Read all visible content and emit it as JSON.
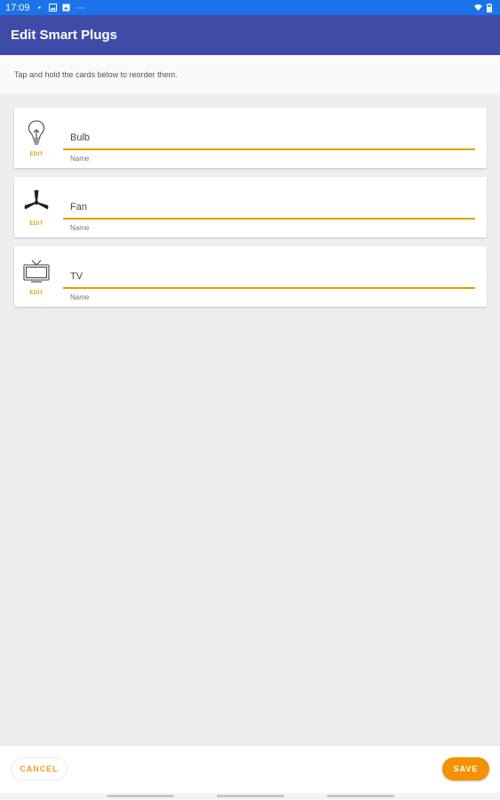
{
  "status_bar": {
    "time": "17:09",
    "left_icons": [
      "dot-icon",
      "image-icon",
      "photo-icon",
      "more-icon"
    ],
    "right_icons": [
      "wifi-icon",
      "battery-icon"
    ]
  },
  "app_bar": {
    "title": "Edit Smart Plugs"
  },
  "hint": {
    "text": "Tap and hold the cards below to reorder them."
  },
  "cards": [
    {
      "icon": "bulb-icon",
      "edit_label": "EDIT",
      "value": "Bulb",
      "helper": "Name"
    },
    {
      "icon": "fan-icon",
      "edit_label": "EDIT",
      "value": "Fan",
      "helper": "Name"
    },
    {
      "icon": "tv-icon",
      "edit_label": "EDIT",
      "value": "TV",
      "helper": "Name"
    }
  ],
  "footer": {
    "cancel_label": "CANCEL",
    "save_label": "SAVE"
  },
  "colors": {
    "status_bar": "#1a73e8",
    "app_bar": "#3f4ba6",
    "accent": "#d9a300",
    "save_button": "#f39200",
    "cancel_text": "#f29a1c"
  }
}
